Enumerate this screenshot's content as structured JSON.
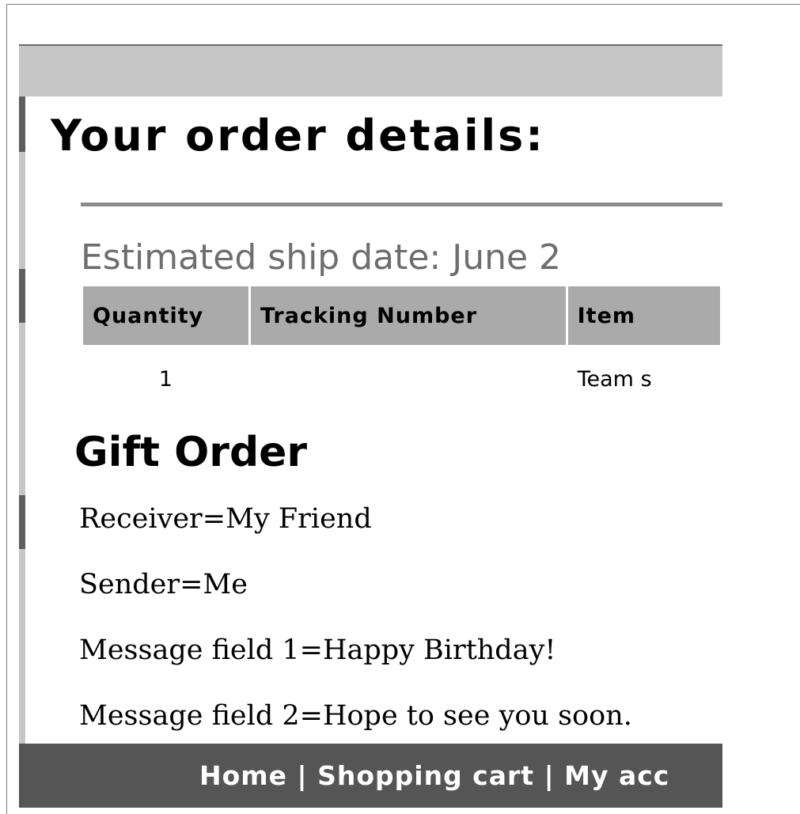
{
  "page": {
    "title": "Your order details:"
  },
  "order": {
    "estimated_ship_date": "Estimated ship date: June 2",
    "columns": [
      "Quantity",
      "Tracking Number",
      "Item"
    ],
    "rows": [
      {
        "quantity": "1",
        "tracking_number": "",
        "item": "Team s"
      }
    ]
  },
  "gift": {
    "title": "Gift Order",
    "receiver": "Receiver=My Friend",
    "sender": "Sender=Me",
    "message1": "Message field 1=Happy Birthday!",
    "message2": "Message field 2=Hope to see you soon."
  },
  "footer": {
    "links": [
      "Home",
      "Shopping cart",
      "My acc"
    ],
    "separator": " | "
  },
  "colors": {
    "header_bar": "#c6c6c6",
    "table_header": "#aaaaaa",
    "footer_bar": "#555555",
    "ship_date_text": "#6e6e6e"
  }
}
